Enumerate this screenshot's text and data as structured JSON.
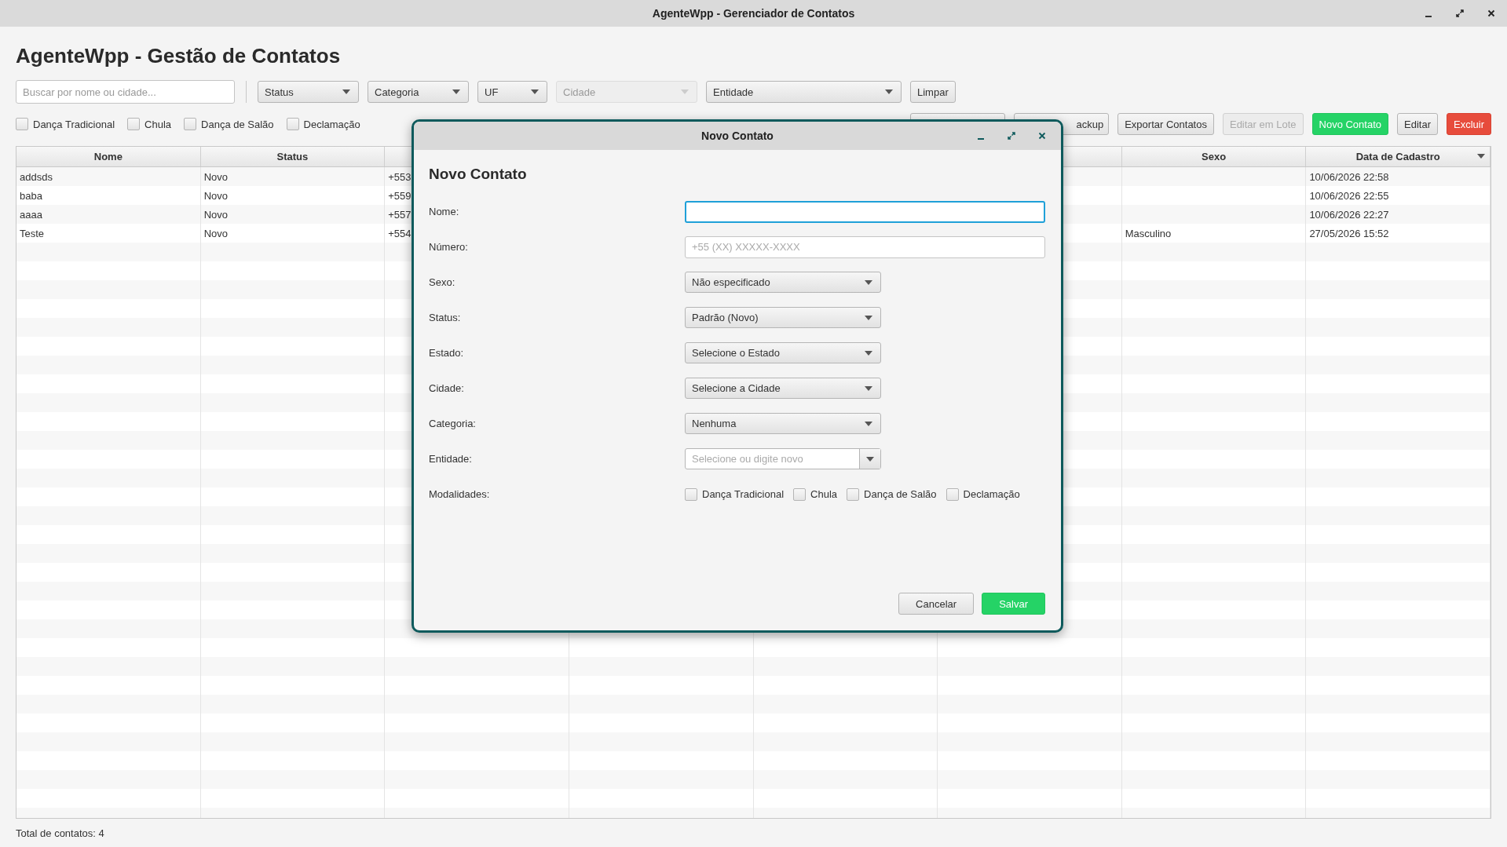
{
  "window": {
    "title": "AgenteWpp - Gerenciador de Contatos"
  },
  "page_title": "AgenteWpp - Gestão de Contatos",
  "filters": {
    "search": {
      "placeholder": "Buscar por nome ou cidade..."
    },
    "dropdowns": [
      {
        "label": "Status",
        "disabled": false
      },
      {
        "label": "Categoria",
        "disabled": false
      },
      {
        "label": "UF",
        "disabled": false
      },
      {
        "label": "Cidade",
        "disabled": true
      },
      {
        "label": "Entidade",
        "disabled": false
      }
    ],
    "clear_button": "Limpar"
  },
  "modalities": [
    {
      "label": "Dança Tradicional",
      "checked": false
    },
    {
      "label": "Chula",
      "checked": false
    },
    {
      "label": "Dança de Salão",
      "checked": false
    },
    {
      "label": "Declamação",
      "checked": false
    }
  ],
  "actions": [
    {
      "kind": "default",
      "disabled": false
    },
    {
      "label": "ackup",
      "kind": "default",
      "disabled": false
    },
    {
      "label": "Exportar Contatos",
      "kind": "default",
      "disabled": false
    },
    {
      "label": "Editar em Lote",
      "kind": "default",
      "disabled": true
    },
    {
      "label": "Novo Contato",
      "kind": "primary",
      "disabled": false
    },
    {
      "label": "Editar",
      "kind": "default",
      "disabled": false
    },
    {
      "label": "Excluir",
      "kind": "danger",
      "disabled": false
    }
  ],
  "table": {
    "columns": [
      {
        "label": "Nome"
      },
      {
        "label": "Status"
      },
      {},
      {},
      {},
      {},
      {
        "label": "Sexo"
      },
      {
        "label": "Data de Cadastro",
        "sort_descending": true
      }
    ],
    "rows": [
      {
        "cells": [
          "addsds",
          "Novo",
          "+553",
          null,
          null,
          null,
          null,
          "10/06/2026 22:58"
        ]
      },
      {
        "cells": [
          "baba",
          "Novo",
          "+559",
          null,
          null,
          null,
          null,
          "10/06/2026 22:55"
        ]
      },
      {
        "cells": [
          "aaaa",
          "Novo",
          "+557",
          null,
          null,
          null,
          null,
          "10/06/2026 22:27"
        ]
      },
      {
        "cells": [
          "Teste",
          "Novo",
          "+554",
          null,
          null,
          null,
          "Masculino",
          "27/05/2026 15:52"
        ]
      }
    ]
  },
  "status_bar": "Total de contatos: 4",
  "dialog": {
    "title": "Novo Contato",
    "heading": "Novo Contato",
    "fields": [
      {
        "label": "Nome:",
        "kind": "text",
        "focused": true
      },
      {
        "label": "Número:",
        "kind": "text",
        "placeholder": "+55 (XX) XXXXX-XXXX",
        "focused": false
      },
      {
        "label": "Sexo:",
        "kind": "select",
        "value": "Não especificado"
      },
      {
        "label": "Status:",
        "kind": "select",
        "value": "Padrão (Novo)"
      },
      {
        "label": "Estado:",
        "kind": "select",
        "value": "Selecione o Estado"
      },
      {
        "label": "Cidade:",
        "kind": "select",
        "value": "Selecione a Cidade"
      },
      {
        "label": "Categoria:",
        "kind": "select",
        "value": "Nenhuma"
      },
      {
        "label": "Entidade:",
        "kind": "combo",
        "placeholder": "Selecione ou digite novo"
      },
      {
        "label": "Modalidades:",
        "kind": "checks",
        "options": [
          {
            "label": "Dança Tradicional",
            "checked": false
          },
          {
            "label": "Chula",
            "checked": false
          },
          {
            "label": "Dança de Salão",
            "checked": false
          },
          {
            "label": "Declamação",
            "checked": false
          }
        ]
      }
    ],
    "buttons": [
      {
        "label": "Cancelar",
        "kind": "default"
      },
      {
        "label": "Salvar",
        "kind": "primary"
      }
    ]
  }
}
